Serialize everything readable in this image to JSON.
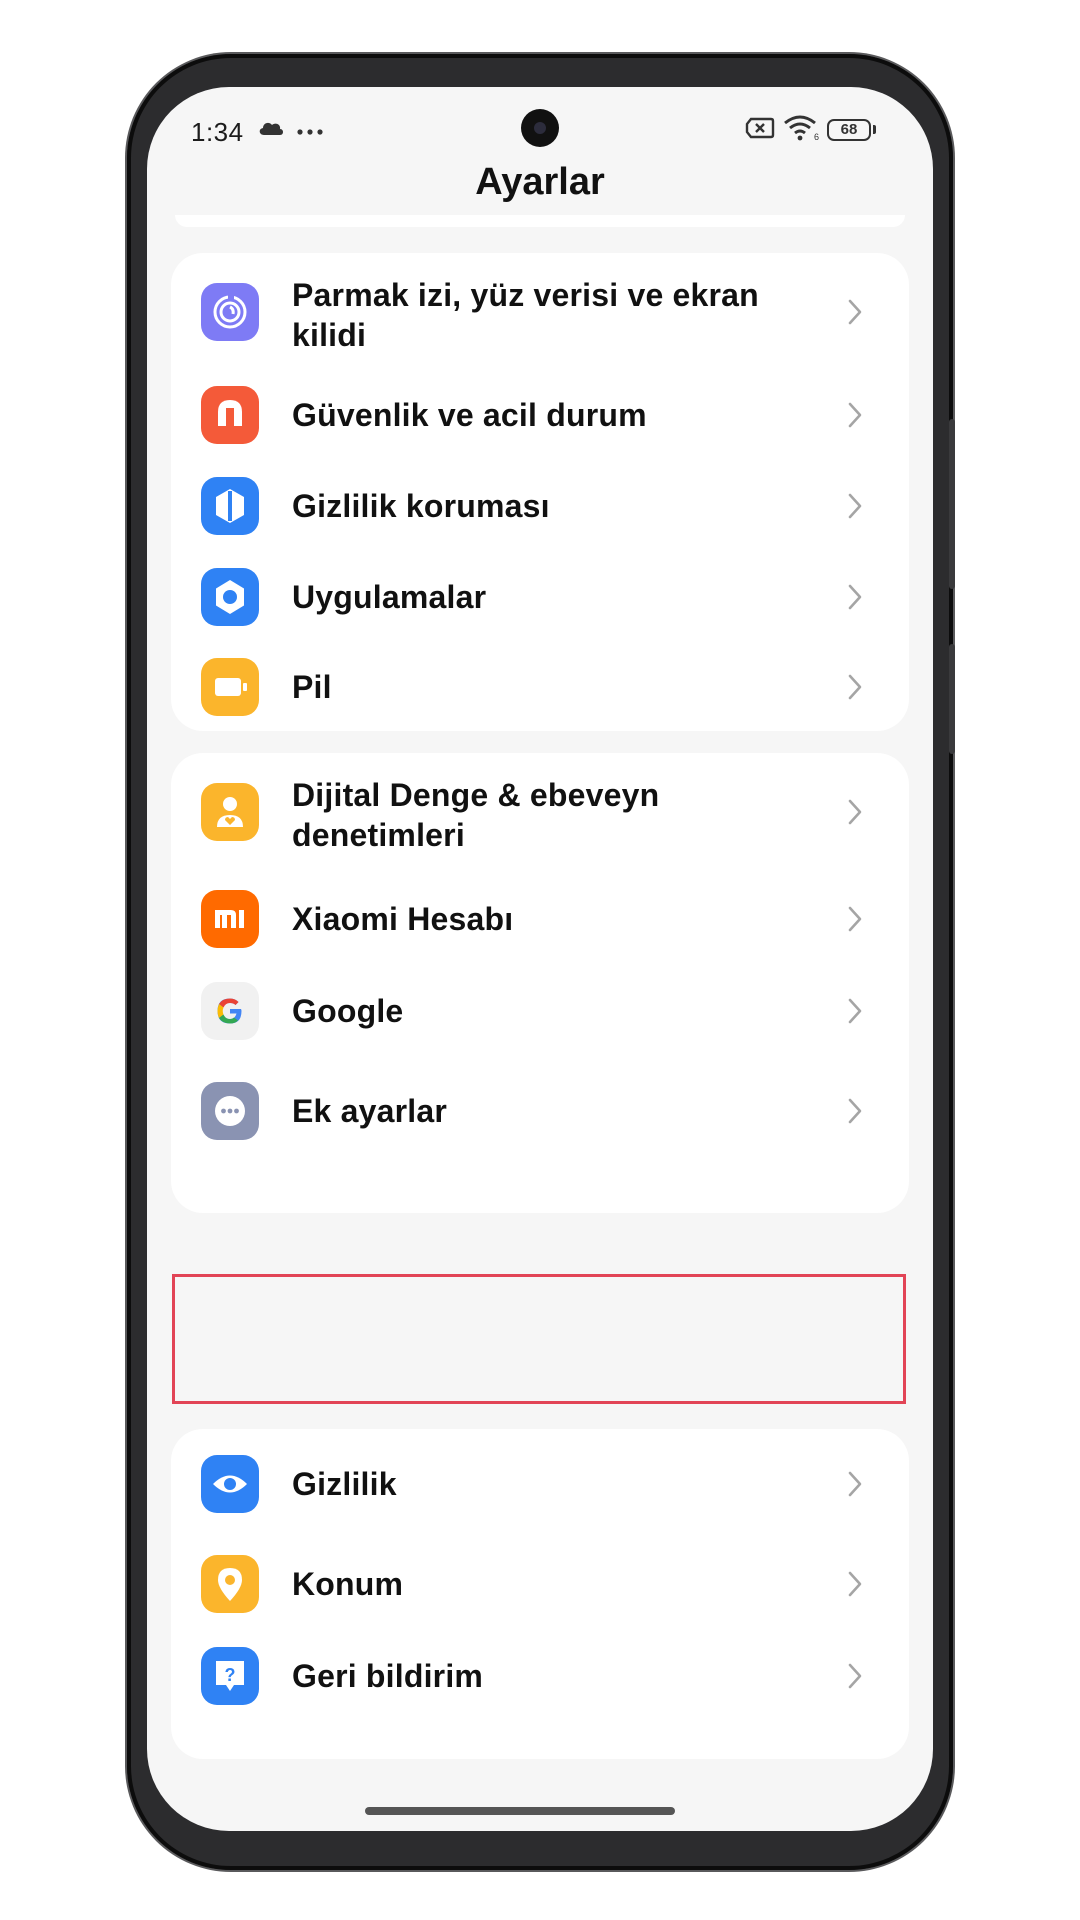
{
  "status_bar": {
    "time": "1:34",
    "battery": "68",
    "icons": [
      "cloud-icon",
      "more-dots-icon",
      "sim-off-icon",
      "wifi-icon",
      "battery-icon"
    ]
  },
  "header": {
    "title": "Ayarlar"
  },
  "groups": [
    {
      "items": [
        {
          "label": "Parmak izi, yüz verisi ve ekran kilidi",
          "icon": "fingerprint-icon",
          "color": "#7E7BF5"
        },
        {
          "label": "Güvenlik ve acil durum",
          "icon": "alarm-bell-icon",
          "color": "#F45A39"
        },
        {
          "label": "Gizlilik koruması",
          "icon": "shield-icon",
          "color": "#2F82F4"
        },
        {
          "label": "Uygulamalar",
          "icon": "apps-hexagon-icon",
          "color": "#2F82F4"
        },
        {
          "label": "Pil",
          "icon": "battery-icon",
          "color": "#FBB52C"
        }
      ]
    },
    {
      "items": [
        {
          "label": "Dijital Denge & ebeveyn denetimleri",
          "icon": "person-heart-icon",
          "color": "#FBB52C"
        },
        {
          "label": "Xiaomi Hesabı",
          "icon": "mi-logo-icon",
          "color": "#FF6A00"
        },
        {
          "label": "Google",
          "icon": "google-g-icon",
          "color": "#F1F1F1"
        },
        {
          "label": "Ek ayarlar",
          "icon": "more-dots-icon",
          "color": "#8A93B2"
        }
      ]
    },
    {
      "items": [
        {
          "label": "Gizlilik",
          "icon": "eye-icon",
          "color": "#2F82F4"
        },
        {
          "label": "Konum",
          "icon": "location-pin-icon",
          "color": "#FBB52C"
        },
        {
          "label": "Geri bildirim",
          "icon": "feedback-icon",
          "color": "#2F82F4"
        }
      ]
    }
  ],
  "highlight_color": "#E24456"
}
